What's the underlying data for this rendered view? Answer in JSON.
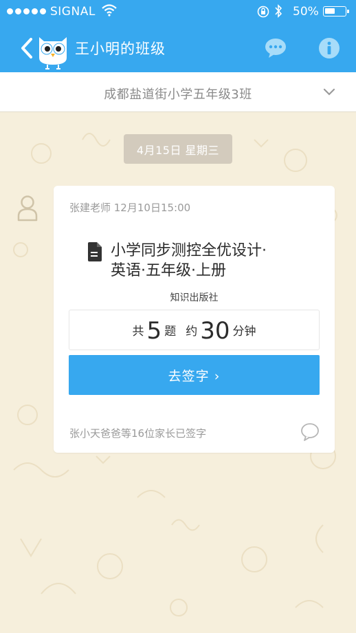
{
  "status_bar": {
    "carrier": "SIGNAL",
    "battery_percent": "50%",
    "battery_level": 0.5
  },
  "nav": {
    "title": "王小明的班级"
  },
  "class_selector": {
    "value": "成都盐道街小学五年级3班"
  },
  "date_pill": "4月15日 星期三",
  "card": {
    "meta": "张建老师 12月10日15:00",
    "book_title_line1": "小学同步测控全优设计·",
    "book_title_line2": "英语·五年级·上册",
    "publisher": "知识出版社",
    "stats": {
      "prefix": "共",
      "count": "5",
      "count_unit": "题",
      "approx": "约",
      "minutes": "30",
      "minutes_unit": "分钟"
    },
    "sign_button": "去签字 ›",
    "signed_text": "张小天爸爸等16位家长已签字"
  },
  "colors": {
    "brand_blue": "#37a8ef",
    "background": "#f6efdc",
    "pill": "#d3cbbd"
  },
  "icons": [
    "back-icon",
    "owl-logo-icon",
    "chat-bubble-icon",
    "info-icon",
    "chevron-down-icon",
    "avatar-icon",
    "document-icon",
    "comment-icon"
  ]
}
